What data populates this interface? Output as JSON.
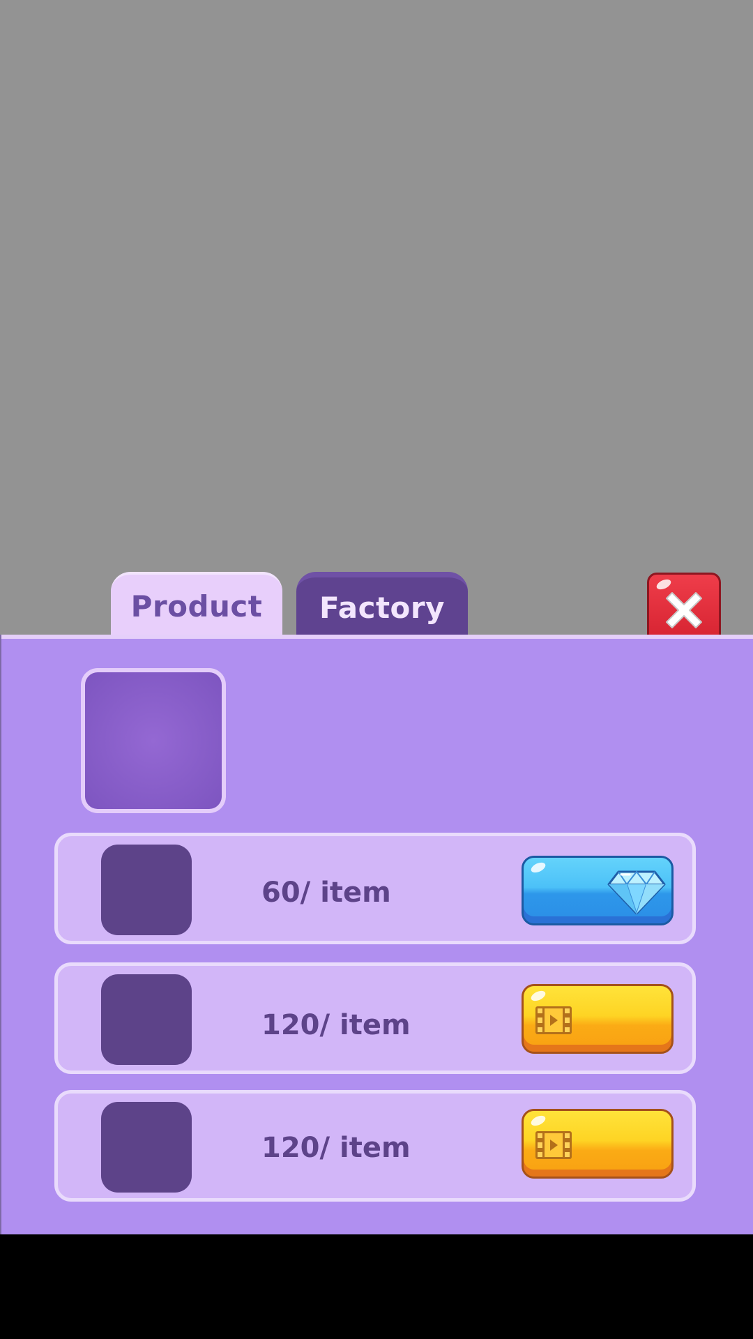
{
  "tabs": [
    {
      "label": "Product",
      "active": true
    },
    {
      "label": "Factory",
      "active": false
    }
  ],
  "close_button": {
    "icon": "close-x-icon"
  },
  "preview": {
    "icon": "product-preview-slot"
  },
  "rows": [
    {
      "price": "60/ item",
      "button_type": "gem",
      "icon": "diamond-icon"
    },
    {
      "price": "120/ item",
      "button_type": "video-ad",
      "icon": "film-play-icon"
    },
    {
      "price": "120/ item",
      "button_type": "video-ad",
      "icon": "film-play-icon"
    }
  ],
  "colors": {
    "backdrop": "#939393",
    "panel": "#b08ff0",
    "row": "#d2b6f8",
    "thumb": "#5d4389",
    "tab_active": "#e8cffb",
    "tab_inactive": "#5f4390",
    "close": "#d3202e",
    "gem_button": "#4cc1f8",
    "video_button": "#fed424"
  }
}
